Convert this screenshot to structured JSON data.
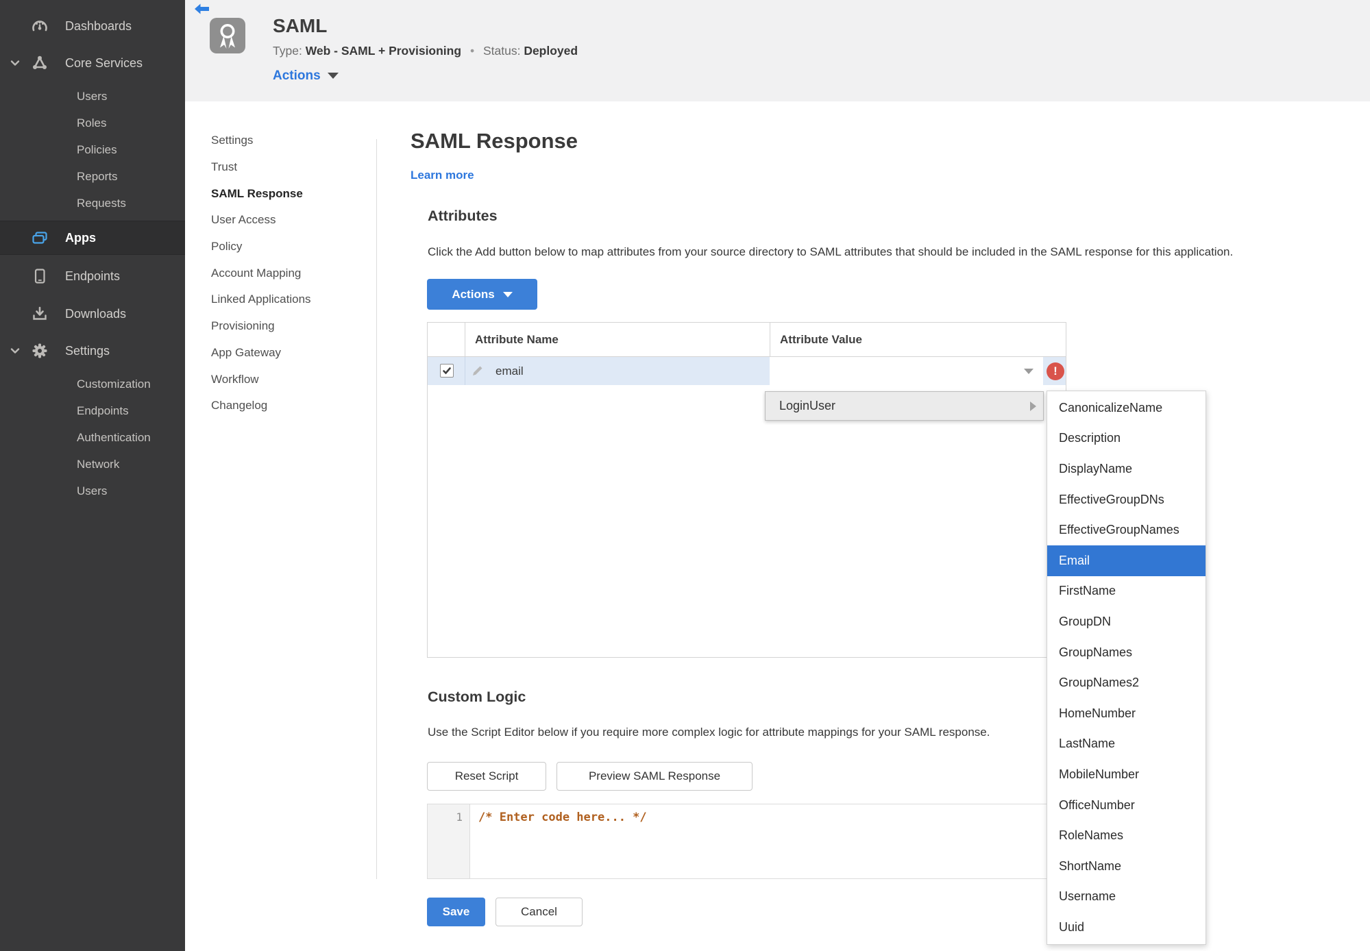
{
  "sidebar": {
    "dashboards": "Dashboards",
    "core_services": "Core Services",
    "core_children": [
      "Users",
      "Roles",
      "Policies",
      "Reports",
      "Requests"
    ],
    "apps": "Apps",
    "endpoints": "Endpoints",
    "downloads": "Downloads",
    "settings": "Settings",
    "settings_children": [
      "Customization",
      "Endpoints",
      "Authentication",
      "Network",
      "Users"
    ]
  },
  "header": {
    "title": "SAML",
    "type_label": "Type:",
    "type_value": "Web - SAML + Provisioning",
    "dot": "•",
    "status_label": "Status:",
    "status_value": "Deployed",
    "actions_label": "Actions"
  },
  "subnav": {
    "items": [
      "Settings",
      "Trust",
      "SAML Response",
      "User Access",
      "Policy",
      "Account Mapping",
      "Linked Applications",
      "Provisioning",
      "App Gateway",
      "Workflow",
      "Changelog"
    ],
    "active": "SAML Response"
  },
  "main": {
    "title": "SAML Response",
    "learn_more": "Learn more",
    "attributes_heading": "Attributes",
    "attributes_description": "Click the Add button below to map attributes from your source directory to SAML attributes that should be included in the SAML response for this application.",
    "actions_button": "Actions",
    "table": {
      "col_name": "Attribute Name",
      "col_value": "Attribute Value",
      "row": {
        "name": "email",
        "checked": true,
        "value": "",
        "error": "!"
      }
    },
    "value_menu": {
      "item": "LoginUser",
      "submenu": [
        "CanonicalizeName",
        "Description",
        "DisplayName",
        "EffectiveGroupDNs",
        "EffectiveGroupNames",
        "Email",
        "FirstName",
        "GroupDN",
        "GroupNames",
        "GroupNames2",
        "HomeNumber",
        "LastName",
        "MobileNumber",
        "OfficeNumber",
        "RoleNames",
        "ShortName",
        "Username",
        "Uuid"
      ],
      "selected": "Email"
    },
    "custom_logic_heading": "Custom Logic",
    "custom_logic_description": "Use the Script Editor below if you require more complex logic for attribute mappings for your SAML response.",
    "reset_button": "Reset Script",
    "preview_button": "Preview SAML Response",
    "editor": {
      "line_number": "1",
      "code": "/* Enter code here... */"
    },
    "save_button": "Save",
    "cancel_button": "Cancel"
  },
  "icons": {
    "back": "arrow-left",
    "app_badge": "award-ribbon",
    "dashboards": "gauge",
    "core_services": "nodes-triangle",
    "apps": "stacked-windows",
    "endpoints": "mobile-phone",
    "downloads": "download-tray",
    "settings": "gear",
    "expand": "chevron-down",
    "edit": "pencil",
    "dropdown": "caret-down",
    "error": "exclamation-circle",
    "submenu": "caret-right",
    "checkbox": "check-mark"
  },
  "colors": {
    "sidebar_bg": "#39393a",
    "sidebar_active_bg": "#2f2f30",
    "header_bg": "#f1f1f2",
    "accent_blue": "#3c80d8",
    "link_blue": "#2d77dd",
    "apps_icon_blue": "#49a4e9",
    "status_green": "#4f9a33",
    "selected_blue": "#3277d3",
    "error_red": "#d9544b",
    "row_blue": "#dfe9f6",
    "comment_orange": "#b0601f"
  }
}
